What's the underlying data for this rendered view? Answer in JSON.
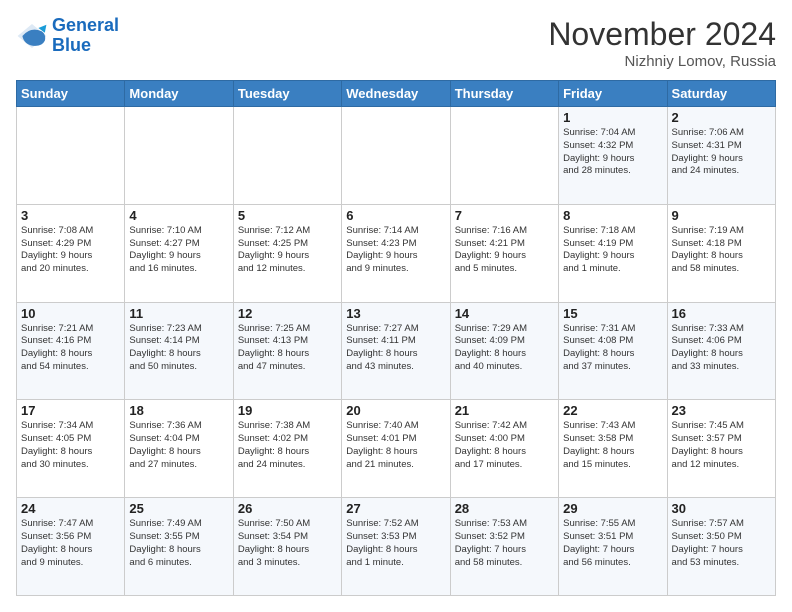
{
  "header": {
    "logo_line1": "General",
    "logo_line2": "Blue",
    "month_title": "November 2024",
    "location": "Nizhniy Lomov, Russia"
  },
  "weekdays": [
    "Sunday",
    "Monday",
    "Tuesday",
    "Wednesday",
    "Thursday",
    "Friday",
    "Saturday"
  ],
  "weeks": [
    [
      {
        "day": "",
        "info": ""
      },
      {
        "day": "",
        "info": ""
      },
      {
        "day": "",
        "info": ""
      },
      {
        "day": "",
        "info": ""
      },
      {
        "day": "",
        "info": ""
      },
      {
        "day": "1",
        "info": "Sunrise: 7:04 AM\nSunset: 4:32 PM\nDaylight: 9 hours\nand 28 minutes."
      },
      {
        "day": "2",
        "info": "Sunrise: 7:06 AM\nSunset: 4:31 PM\nDaylight: 9 hours\nand 24 minutes."
      }
    ],
    [
      {
        "day": "3",
        "info": "Sunrise: 7:08 AM\nSunset: 4:29 PM\nDaylight: 9 hours\nand 20 minutes."
      },
      {
        "day": "4",
        "info": "Sunrise: 7:10 AM\nSunset: 4:27 PM\nDaylight: 9 hours\nand 16 minutes."
      },
      {
        "day": "5",
        "info": "Sunrise: 7:12 AM\nSunset: 4:25 PM\nDaylight: 9 hours\nand 12 minutes."
      },
      {
        "day": "6",
        "info": "Sunrise: 7:14 AM\nSunset: 4:23 PM\nDaylight: 9 hours\nand 9 minutes."
      },
      {
        "day": "7",
        "info": "Sunrise: 7:16 AM\nSunset: 4:21 PM\nDaylight: 9 hours\nand 5 minutes."
      },
      {
        "day": "8",
        "info": "Sunrise: 7:18 AM\nSunset: 4:19 PM\nDaylight: 9 hours\nand 1 minute."
      },
      {
        "day": "9",
        "info": "Sunrise: 7:19 AM\nSunset: 4:18 PM\nDaylight: 8 hours\nand 58 minutes."
      }
    ],
    [
      {
        "day": "10",
        "info": "Sunrise: 7:21 AM\nSunset: 4:16 PM\nDaylight: 8 hours\nand 54 minutes."
      },
      {
        "day": "11",
        "info": "Sunrise: 7:23 AM\nSunset: 4:14 PM\nDaylight: 8 hours\nand 50 minutes."
      },
      {
        "day": "12",
        "info": "Sunrise: 7:25 AM\nSunset: 4:13 PM\nDaylight: 8 hours\nand 47 minutes."
      },
      {
        "day": "13",
        "info": "Sunrise: 7:27 AM\nSunset: 4:11 PM\nDaylight: 8 hours\nand 43 minutes."
      },
      {
        "day": "14",
        "info": "Sunrise: 7:29 AM\nSunset: 4:09 PM\nDaylight: 8 hours\nand 40 minutes."
      },
      {
        "day": "15",
        "info": "Sunrise: 7:31 AM\nSunset: 4:08 PM\nDaylight: 8 hours\nand 37 minutes."
      },
      {
        "day": "16",
        "info": "Sunrise: 7:33 AM\nSunset: 4:06 PM\nDaylight: 8 hours\nand 33 minutes."
      }
    ],
    [
      {
        "day": "17",
        "info": "Sunrise: 7:34 AM\nSunset: 4:05 PM\nDaylight: 8 hours\nand 30 minutes."
      },
      {
        "day": "18",
        "info": "Sunrise: 7:36 AM\nSunset: 4:04 PM\nDaylight: 8 hours\nand 27 minutes."
      },
      {
        "day": "19",
        "info": "Sunrise: 7:38 AM\nSunset: 4:02 PM\nDaylight: 8 hours\nand 24 minutes."
      },
      {
        "day": "20",
        "info": "Sunrise: 7:40 AM\nSunset: 4:01 PM\nDaylight: 8 hours\nand 21 minutes."
      },
      {
        "day": "21",
        "info": "Sunrise: 7:42 AM\nSunset: 4:00 PM\nDaylight: 8 hours\nand 17 minutes."
      },
      {
        "day": "22",
        "info": "Sunrise: 7:43 AM\nSunset: 3:58 PM\nDaylight: 8 hours\nand 15 minutes."
      },
      {
        "day": "23",
        "info": "Sunrise: 7:45 AM\nSunset: 3:57 PM\nDaylight: 8 hours\nand 12 minutes."
      }
    ],
    [
      {
        "day": "24",
        "info": "Sunrise: 7:47 AM\nSunset: 3:56 PM\nDaylight: 8 hours\nand 9 minutes."
      },
      {
        "day": "25",
        "info": "Sunrise: 7:49 AM\nSunset: 3:55 PM\nDaylight: 8 hours\nand 6 minutes."
      },
      {
        "day": "26",
        "info": "Sunrise: 7:50 AM\nSunset: 3:54 PM\nDaylight: 8 hours\nand 3 minutes."
      },
      {
        "day": "27",
        "info": "Sunrise: 7:52 AM\nSunset: 3:53 PM\nDaylight: 8 hours\nand 1 minute."
      },
      {
        "day": "28",
        "info": "Sunrise: 7:53 AM\nSunset: 3:52 PM\nDaylight: 7 hours\nand 58 minutes."
      },
      {
        "day": "29",
        "info": "Sunrise: 7:55 AM\nSunset: 3:51 PM\nDaylight: 7 hours\nand 56 minutes."
      },
      {
        "day": "30",
        "info": "Sunrise: 7:57 AM\nSunset: 3:50 PM\nDaylight: 7 hours\nand 53 minutes."
      }
    ]
  ]
}
